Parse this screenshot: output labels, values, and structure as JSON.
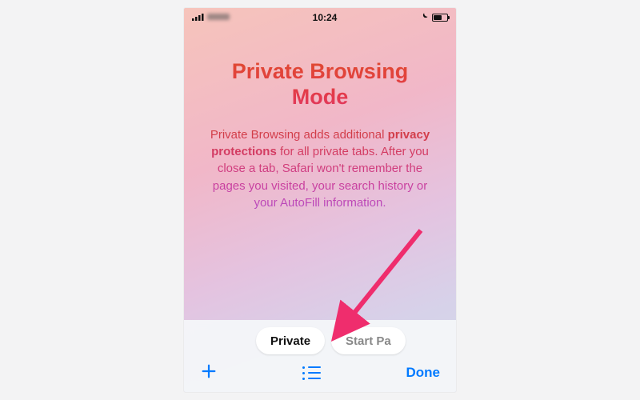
{
  "statusbar": {
    "time": "10:24"
  },
  "page": {
    "title": "Private Browsing Mode",
    "body_prefix": "Private Browsing adds additional ",
    "body_bold": "privacy protections",
    "body_suffix": " for all private tabs. After you close a tab, Safari won't remember the pages you visited, your search history or your AutoFill information."
  },
  "tabs": {
    "private": "Private",
    "startpage": "Start Pa"
  },
  "toolbar": {
    "done": "Done"
  }
}
